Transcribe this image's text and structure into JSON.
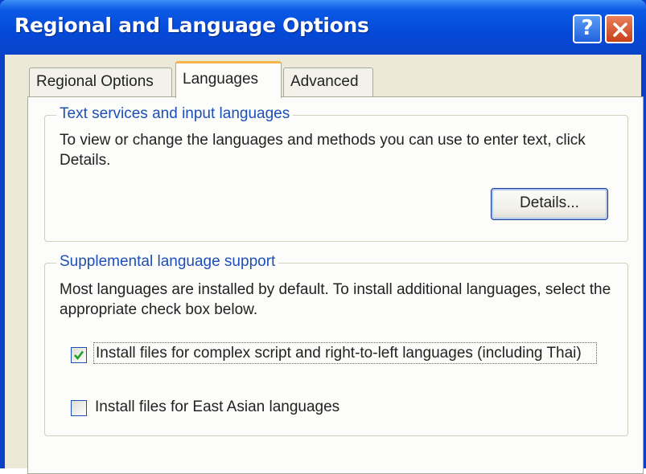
{
  "window": {
    "title": "Regional and Language Options",
    "help_label": "?",
    "accent_color": "#0a5ae6",
    "close_color": "#d8582c"
  },
  "tabs": [
    {
      "label": "Regional Options",
      "selected": false
    },
    {
      "label": "Languages",
      "selected": true
    },
    {
      "label": "Advanced",
      "selected": false
    }
  ],
  "text_services": {
    "legend": "Text services and input languages",
    "description": "To view or change the languages and methods you can use to enter text, click Details.",
    "details_button": "Details..."
  },
  "supplemental": {
    "legend": "Supplemental language support",
    "description": "Most languages are installed by default. To install additional languages, select the appropriate check box below.",
    "options": [
      {
        "label": "Install files for complex script and right-to-left languages (including Thai)",
        "checked": true
      },
      {
        "label": "Install files for East Asian languages",
        "checked": false
      }
    ]
  }
}
